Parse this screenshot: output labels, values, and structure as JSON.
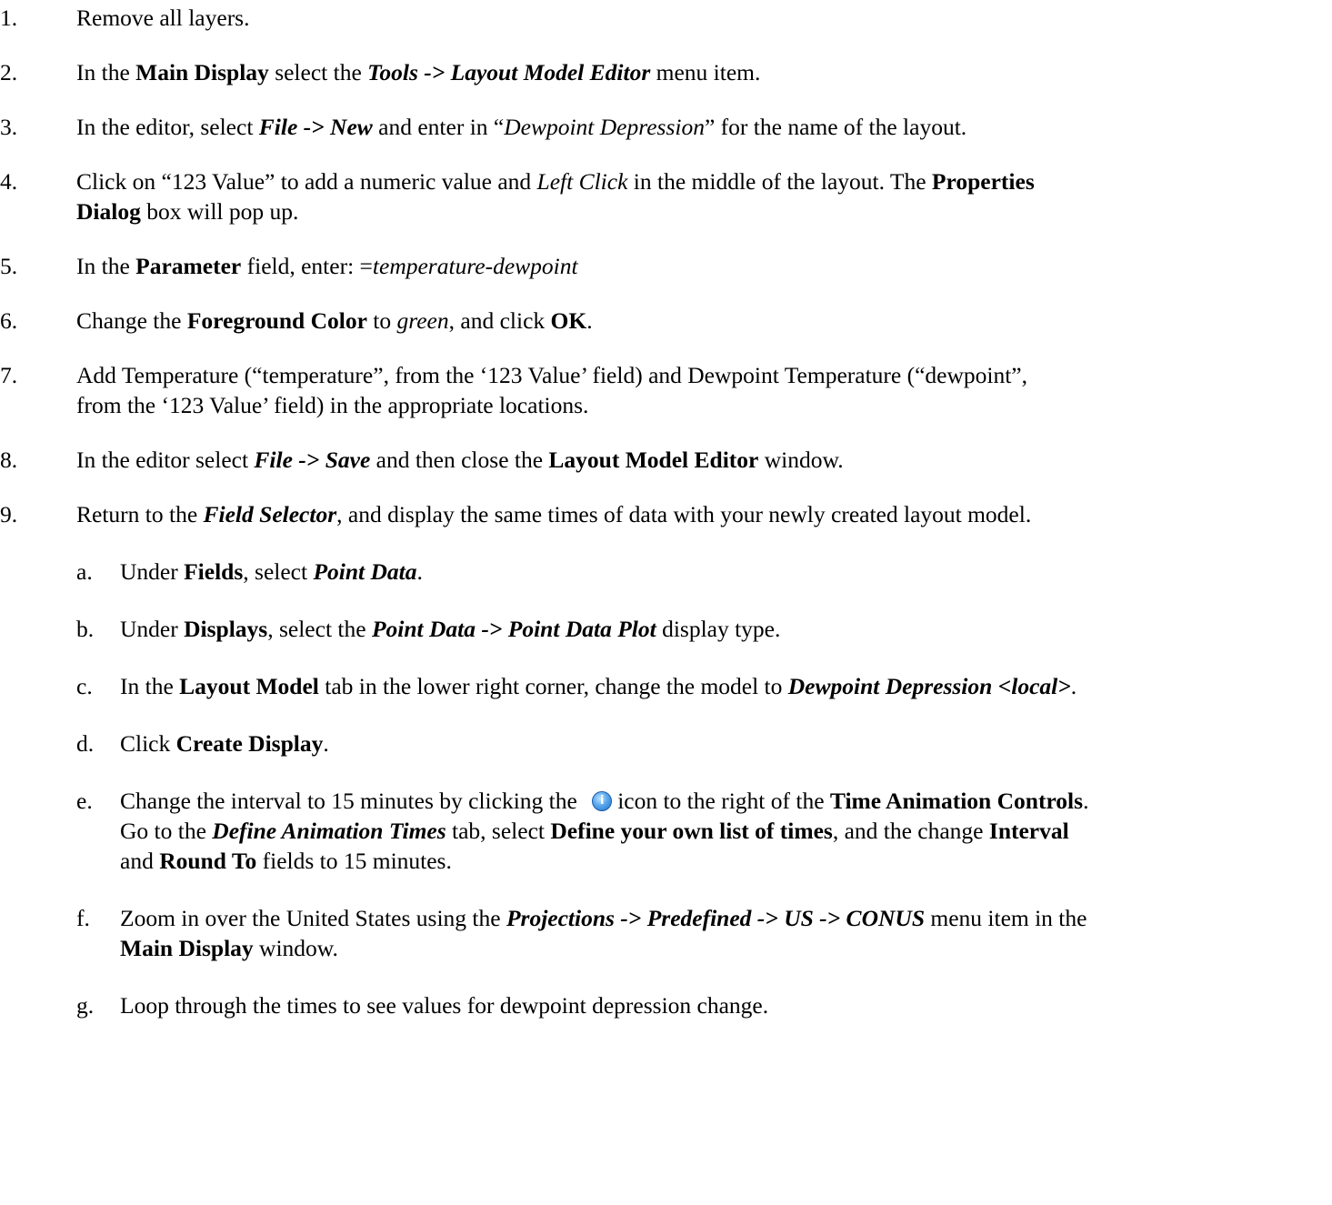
{
  "steps": [
    {
      "num": "1.",
      "text": "Remove all layers."
    },
    {
      "num": "2.",
      "t1": "In the ",
      "b1": "Main Display",
      "t2": " select the ",
      "bi1": "Tools -> Layout Model Editor",
      "t3": " menu item."
    },
    {
      "num": "3.",
      "t1": "In the editor, select ",
      "bi1": "File -> New",
      "t2": " and enter in “",
      "i1": "Dewpoint Depression",
      "t3": "” for the name of the layout."
    },
    {
      "num": "4.",
      "t1": "Click on “123 Value” to add a numeric value and ",
      "i1": "Left Click",
      "t2": " in the middle of the layout.  The ",
      "b1": "Properties",
      "b2": "Dialog",
      "t3": " box will pop up."
    },
    {
      "num": "5.",
      "t1": "In the ",
      "b1": "Parameter",
      "t2": " field, enter:  =",
      "i1": "temperature-dewpoint"
    },
    {
      "num": "6.",
      "t1": "Change the ",
      "b1": "Foreground Color",
      "t2": " to ",
      "i1": "green",
      "t3": ", and click ",
      "b2": "OK",
      "t4": "."
    },
    {
      "num": "7.",
      "line1": "Add Temperature (“temperature”, from the ‘123 Value’ field) and Dewpoint Temperature (“dewpoint”,",
      "line2": "from the ‘123 Value’ field) in the appropriate locations."
    },
    {
      "num": "8.",
      "t1": "In the editor select ",
      "bi1": "File -> Save",
      "t2": " and then close the ",
      "b1": "Layout Model Editor",
      "t3": " window."
    },
    {
      "num": "9.",
      "t1": "Return to the ",
      "bi1": "Field Selector",
      "t2": ", and display the same times of data with your newly created layout model."
    }
  ],
  "substeps": [
    {
      "num": "a.",
      "t1": "Under ",
      "b1": "Fields",
      "t2": ", select ",
      "bi1": "Point Data",
      "t3": "."
    },
    {
      "num": "b.",
      "t1": "Under ",
      "b1": "Displays",
      "t2": ", select the ",
      "bi1": "Point Data -> Point Data Plot",
      "t3": " display type."
    },
    {
      "num": "c.",
      "t1": "In the ",
      "b1": "Layout Model",
      "t2": " tab in the lower right corner, change the model to ",
      "bi1": "Dewpoint Depression <local>",
      "t3": "."
    },
    {
      "num": "d.",
      "t1": "Click ",
      "b1": "Create Display",
      "t2": "."
    },
    {
      "num": "e.",
      "t1": "Change the interval to 15 minutes by clicking the ",
      "icon": "info-icon",
      "t2": "icon to the right of the ",
      "b1": "Time Animation Controls",
      "t3": ".",
      "t4": "Go to the ",
      "bi1": "Define Animation Times",
      "t5": " tab, select ",
      "b2": "Define your own list of times",
      "t6": ", and the change ",
      "b3": "Interval",
      "t7": "and ",
      "b4": "Round To",
      "t8": " fields to 15 minutes."
    },
    {
      "num": "f.",
      "t1": "Zoom in over the United States using the ",
      "bi1": "Projections -> Predefined -> US -> CONUS",
      "t2": " menu item in the",
      "b1": "Main Display",
      "t3": " window."
    },
    {
      "num": "g.",
      "t1": "Loop through the times to see values for dewpoint depression change."
    }
  ]
}
